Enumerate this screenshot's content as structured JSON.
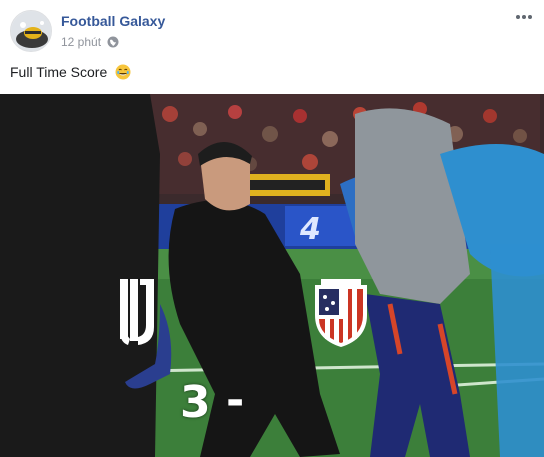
{
  "post": {
    "author": "Football Galaxy",
    "timestamp": "12 phút",
    "privacy_icon": "globe-icon",
    "menu_icon": "more-horizontal-icon",
    "caption": "Full Time Score",
    "caption_emoji": "laughing-face-emoji"
  },
  "image": {
    "score_home": "3",
    "score_separator": "-",
    "home_logo": "juventus-logo",
    "away_logo": "atletico-madrid-logo"
  },
  "colors": {
    "name_link": "#365899",
    "meta_text": "#90949c",
    "pitch_green": "#3c7f3a",
    "atletico_red": "#cb3524",
    "atletico_blue": "#272e61"
  }
}
